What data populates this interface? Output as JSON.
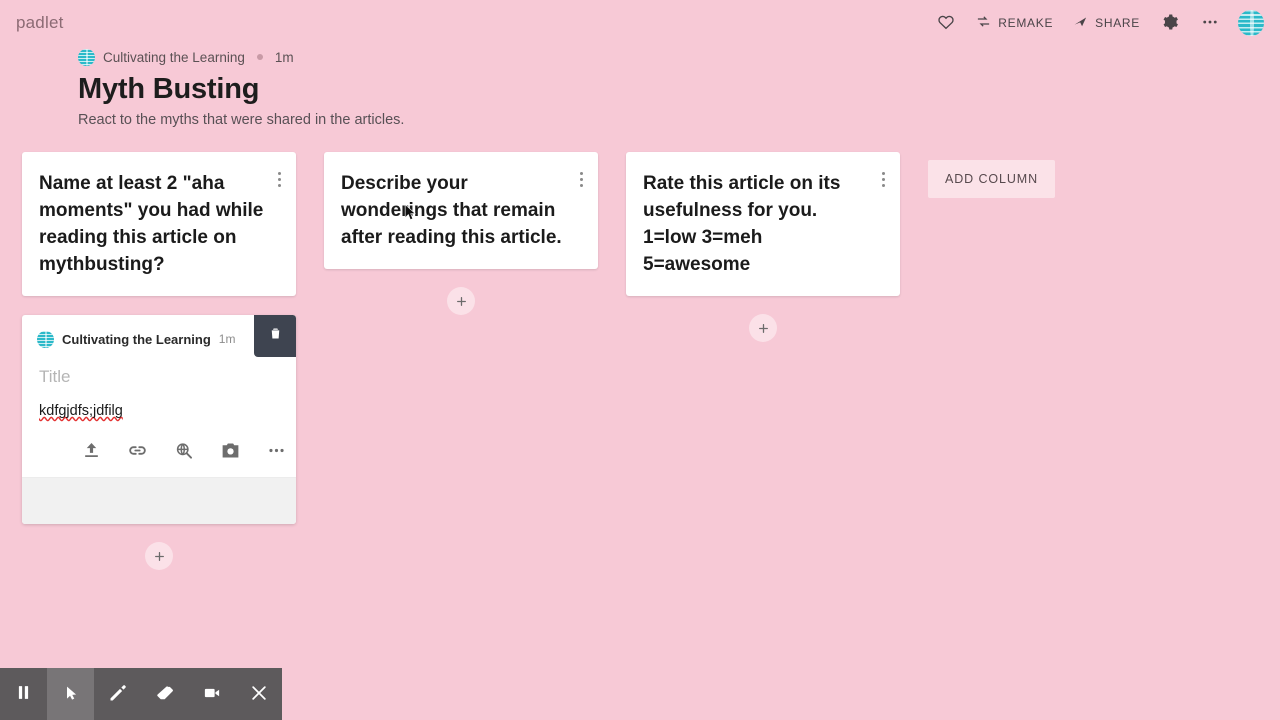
{
  "app": {
    "brand": "padlet",
    "background_color": "#f7c9d6",
    "accent_color": "#fbe1e8"
  },
  "topbar": {
    "like_icon": "heart-icon",
    "remake_label": "REMAKE",
    "remake_icon": "remake-icon",
    "share_label": "SHARE",
    "share_icon": "share-arrow-icon",
    "settings_icon": "gear-icon",
    "more_icon": "ellipsis-icon",
    "avatar_icon": "globe-avatar-icon"
  },
  "board": {
    "author": "Cultivating the Learning",
    "timestamp": "1m",
    "title": "Myth Busting",
    "subtitle": "React to the myths that were shared in the articles.",
    "add_column_label": "ADD COLUMN"
  },
  "columns": [
    {
      "card_text": "Name at least 2 \"aha moments\" you had while reading this article on mythbusting?",
      "add_post_label": "+"
    },
    {
      "card_text": "Describe your wonderings that remain after reading this article.",
      "add_post_label": "+"
    },
    {
      "card_text": "Rate this article on its usefulness for you.\n1=low 3=meh\n5=awesome",
      "add_post_label": "+"
    }
  ],
  "compose": {
    "author": "Cultivating the Learning",
    "timestamp": "1m",
    "delete_icon": "trash-icon",
    "title_placeholder": "Title",
    "body_text": "kdfgjdfs;jdfilg",
    "tools": [
      {
        "name": "upload-icon",
        "label": "Upload"
      },
      {
        "name": "link-icon",
        "label": "Link"
      },
      {
        "name": "web-search-icon",
        "label": "Search the web"
      },
      {
        "name": "camera-icon",
        "label": "Photo"
      },
      {
        "name": "more-options-icon",
        "label": "More"
      }
    ]
  },
  "recorder": {
    "buttons": [
      {
        "name": "pause-button",
        "icon": "pause-icon"
      },
      {
        "name": "pointer-button",
        "icon": "cursor-arrow-icon",
        "active": true
      },
      {
        "name": "pen-button",
        "icon": "pencil-icon"
      },
      {
        "name": "eraser-button",
        "icon": "eraser-icon"
      },
      {
        "name": "record-video-button",
        "icon": "video-camera-icon"
      },
      {
        "name": "close-button",
        "icon": "close-x-icon"
      }
    ]
  }
}
